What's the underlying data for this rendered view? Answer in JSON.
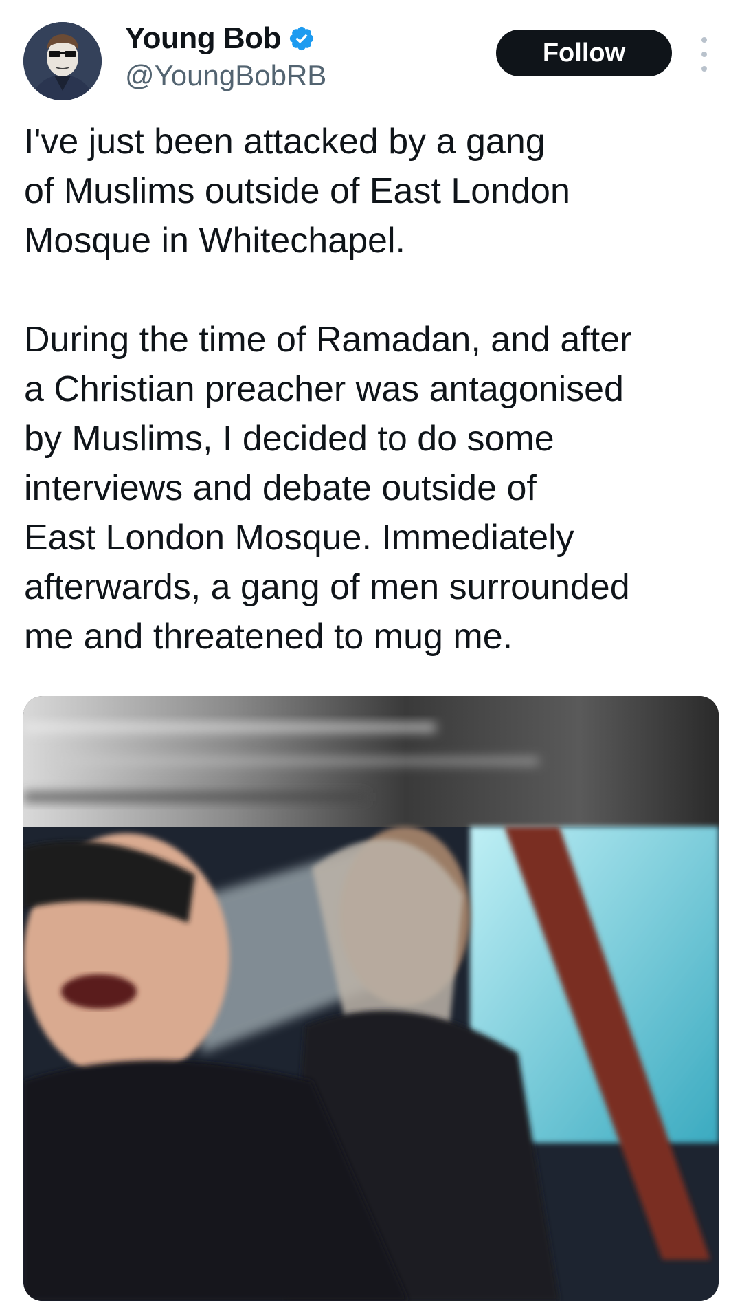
{
  "author": {
    "display_name": "Young Bob",
    "handle": "@YoungBobRB",
    "verified_icon": "verified-badge-icon",
    "verified_color": "#1d9bf0"
  },
  "follow_button": {
    "label": "Follow"
  },
  "more_menu": {
    "icon": "more-vertical-icon"
  },
  "tweet": {
    "text": "I've just been attacked by a gang\nof Muslims outside of East London\nMosque in Whitechapel.\n\nDuring the time of Ramadan, and after\na Christian preacher was antagonised\nby Muslims, I decided to do some\ninterviews and debate outside of\nEast London Mosque. Immediately\nafterwards, a gang of men surrounded\nme and threatened to mug me."
  },
  "media": {
    "type": "video-thumbnail"
  },
  "colors": {
    "text": "#0f1419",
    "secondary": "#536471",
    "button_bg": "#0f1419",
    "button_text": "#ffffff"
  }
}
